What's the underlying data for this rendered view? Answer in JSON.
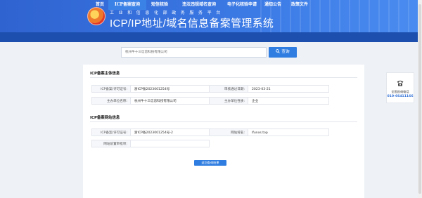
{
  "header": {
    "subtitle": "工业和信息化部政务服务平台",
    "title": "ICP/IP地址/域名信息备案管理系统"
  },
  "nav": {
    "items": [
      {
        "label": "首页"
      },
      {
        "label": "ICP备案查询"
      },
      {
        "label": "短信核验"
      },
      {
        "label": "违法违规域名查询"
      },
      {
        "label": "电子化核验申请"
      },
      {
        "label": "通知公告"
      },
      {
        "label": "政策文件"
      }
    ],
    "active_index": 1
  },
  "search": {
    "value": "杭州牛十三信息科技有限公司",
    "button_label": "查询"
  },
  "sections": {
    "subject": {
      "title": "ICP备案主体信息",
      "rows": [
        [
          "ICP备案/许可证号:",
          "浙ICP备2023001254号",
          "审核通过日期:",
          "2023-03-21"
        ],
        [
          "主办单位名称:",
          "杭州牛十三信息科技有限公司",
          "主办单位性质:",
          "企业"
        ]
      ]
    },
    "website": {
      "title": "ICP备案网站信息",
      "rows": [
        [
          "ICP备案/许可证号:",
          "浙ICP备2023001254号-2",
          "网站域名:",
          "lfunxs.top"
        ],
        [
          "网站前置审批项:",
          ""
        ]
      ]
    }
  },
  "back_button": "返回查询结果",
  "side": {
    "label": "全国咨询电话",
    "number": "010-66411166",
    "icon": "phone-icon"
  },
  "colors": {
    "primary": "#2f7de1",
    "nav": "#1d4fae",
    "header": "#3a78e4"
  }
}
